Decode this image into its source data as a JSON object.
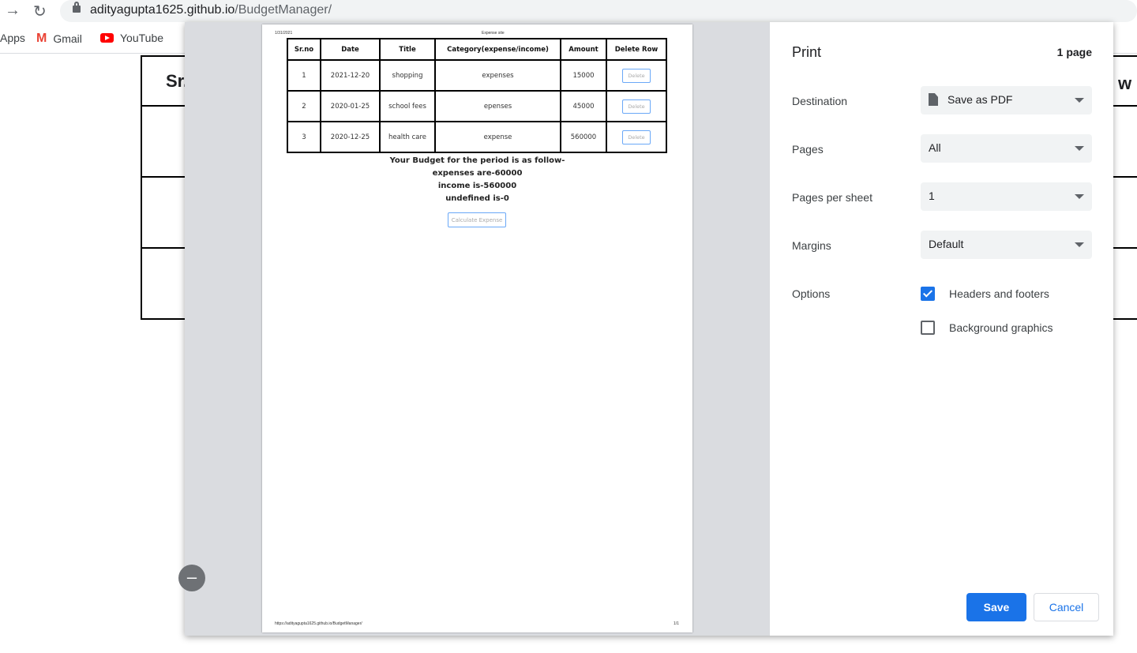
{
  "browser": {
    "url_host": "adityagupta1625.github.io",
    "url_path": "/BudgetManager/",
    "bookmarks": [
      {
        "label": "Apps"
      },
      {
        "label": "Gmail"
      },
      {
        "label": "YouTube"
      }
    ]
  },
  "background_table": {
    "header_partial_left": "Sr.",
    "header_partial_right": "w"
  },
  "preview": {
    "header_date": "1/31/2021",
    "header_title": "Expense site",
    "footer_url": "https://adityagupta1625.github.io/BudgetManager/",
    "footer_page": "1/1",
    "columns": [
      "Sr.no",
      "Date",
      "Title",
      "Category(expense/income)",
      "Amount",
      "Delete Row"
    ],
    "rows": [
      {
        "sr": "1",
        "date": "2021-12-20",
        "title": "shopping",
        "category": "expenses",
        "amount": "15000",
        "action": "Delete"
      },
      {
        "sr": "2",
        "date": "2020-01-25",
        "title": "school fees",
        "category": "epenses",
        "amount": "45000",
        "action": "Delete"
      },
      {
        "sr": "3",
        "date": "2020-12-25",
        "title": "health care",
        "category": "expense",
        "amount": "560000",
        "action": "Delete"
      }
    ],
    "summary": [
      "Your Budget for the period is as follow-",
      "expenses are-60000",
      "income is-560000",
      "undefined is-0"
    ],
    "calculate_label": "Calculate Expense"
  },
  "print": {
    "title": "Print",
    "page_count": "1 page",
    "destination_label": "Destination",
    "destination_value": "Save as PDF",
    "pages_label": "Pages",
    "pages_value": "All",
    "pps_label": "Pages per sheet",
    "pps_value": "1",
    "margins_label": "Margins",
    "margins_value": "Default",
    "options_label": "Options",
    "headers_footers": {
      "label": "Headers and footers",
      "checked": true
    },
    "background_graphics": {
      "label": "Background graphics",
      "checked": false
    },
    "save_label": "Save",
    "cancel_label": "Cancel"
  },
  "colors": {
    "accent": "#1a73e8",
    "preview_bg": "#dadce0"
  }
}
